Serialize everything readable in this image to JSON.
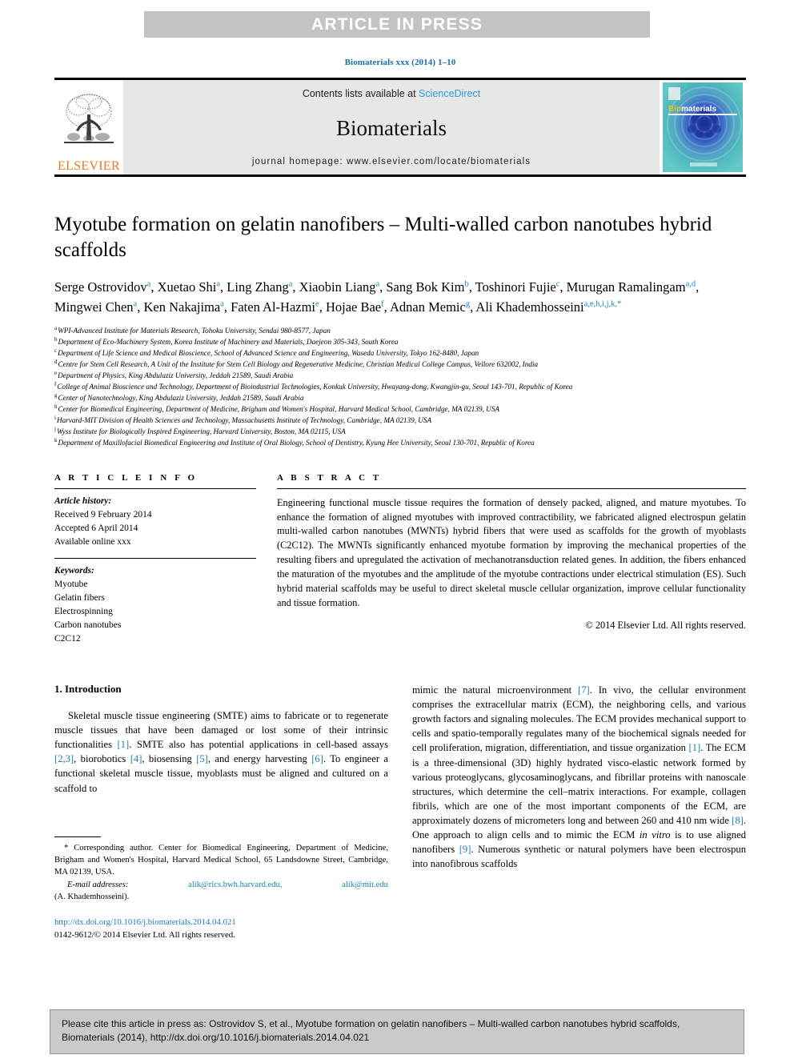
{
  "banner": {
    "label": "ARTICLE IN PRESS"
  },
  "running_head": "Biomaterials xxx (2014) 1–10",
  "masthead": {
    "contents_prefix": "Contents lists available at ",
    "sciencedirect": "ScienceDirect",
    "journal_name": "Biomaterials",
    "homepage": "journal homepage: www.elsevier.com/locate/biomaterials",
    "publisher_wordmark": "ELSEVIER",
    "cover_title_prefix": "Bio",
    "cover_title_suffix": "materials",
    "accent_link": "#2a9fd6",
    "accent_orange": "#e87722",
    "accent_blue": "#1a7fb5"
  },
  "article": {
    "title": "Myotube formation on gelatin nanofibers – Multi-walled carbon nanotubes hybrid scaffolds",
    "authors_html": "Serge Ostrovidov<sup>a</sup>, Xuetao Shi<sup>a</sup>, Ling Zhang<sup>a</sup>, Xiaobin Liang<sup>a</sup>, Sang Bok Kim<sup>b</sup>, Toshinori Fujie<sup>c</sup>, Murugan Ramalingam<sup>a,d</sup>, Mingwei Chen<sup>a</sup>, Ken Nakajima<sup>a</sup>, Faten Al-Hazmi<sup>e</sup>, Hojae Bae<sup>f</sup>, Adnan Memic<sup>g</sup>, Ali Khademhosseini<sup>a,e,h,i,j,k,</sup><sup>*</sup>",
    "affiliations": [
      {
        "mark": "a",
        "text": "WPI-Advanced Institute for Materials Research, Tohoku University, Sendai 980-8577, Japan"
      },
      {
        "mark": "b",
        "text": "Department of Eco-Machinery System, Korea Institute of Machinery and Materials, Daejeon 305-343, South Korea"
      },
      {
        "mark": "c",
        "text": "Department of Life Science and Medical Bioscience, School of Advanced Science and Engineering, Waseda University, Tokyo 162-8480, Japan"
      },
      {
        "mark": "d",
        "text": "Centre for Stem Cell Research, A Unit of the Institute for Stem Cell Biology and Regenerative Medicine, Christian Medical College Campus, Vellore 632002, India"
      },
      {
        "mark": "e",
        "text": "Department of Physics, King Abdulaziz University, Jeddah 21589, Saudi Arabia"
      },
      {
        "mark": "f",
        "text": "College of Animal Bioscience and Technology, Department of Bioindustrial Technologies, Konkuk University, Hwayang-dong, Kwangjin-gu, Seoul 143-701, Republic of Korea"
      },
      {
        "mark": "g",
        "text": "Center of Nanotechnology, King Abdulaziz University, Jeddah 21589, Saudi Arabia"
      },
      {
        "mark": "h",
        "text": "Center for Biomedical Engineering, Department of Medicine, Brigham and Women's Hospital, Harvard Medical School, Cambridge, MA 02139, USA"
      },
      {
        "mark": "i",
        "text": "Harvard-MIT Division of Health Sciences and Technology, Massachusetts Institute of Technology, Cambridge, MA 02139, USA"
      },
      {
        "mark": "j",
        "text": "Wyss Institute for Biologically Inspired Engineering, Harvard University, Boston, MA 02115, USA"
      },
      {
        "mark": "k",
        "text": "Department of Maxillofacial Biomedical Engineering and Institute of Oral Biology, School of Dentistry, Kyung Hee University, Seoul 130-701, Republic of Korea"
      }
    ]
  },
  "article_info": {
    "heading": "A R T I C L E   I N F O",
    "history_label": "Article history:",
    "history": [
      "Received 9 February 2014",
      "Accepted 6 April 2014",
      "Available online xxx"
    ],
    "keywords_label": "Keywords:",
    "keywords": [
      "Myotube",
      "Gelatin fibers",
      "Electrospinning",
      "Carbon nanotubes",
      "C2C12"
    ]
  },
  "abstract": {
    "heading": "A B S T R A C T",
    "body": "Engineering functional muscle tissue requires the formation of densely packed, aligned, and mature myotubes. To enhance the formation of aligned myotubes with improved contractibility, we fabricated aligned electrospun gelatin multi-walled carbon nanotubes (MWNTs) hybrid fibers that were used as scaffolds for the growth of myoblasts (C2C12). The MWNTs significantly enhanced myotube formation by improving the mechanical properties of the resulting fibers and upregulated the activation of mechanotransduction related genes. In addition, the fibers enhanced the maturation of the myotubes and the amplitude of the myotube contractions under electrical stimulation (ES). Such hybrid material scaffolds may be useful to direct skeletal muscle cellular organization, improve cellular functionality and tissue formation.",
    "copyright": "© 2014 Elsevier Ltd. All rights reserved."
  },
  "introduction": {
    "heading": "1. Introduction",
    "left_paragraph_html": "Skeletal muscle tissue engineering (SMTE) aims to fabricate or to regenerate muscle tissues that have been damaged or lost some of their intrinsic functionalities <span class=\"ref\">[1]</span>. SMTE also has potential applications in cell-based assays <span class=\"ref\">[2,3]</span>, biorobotics <span class=\"ref\">[4]</span>, biosensing <span class=\"ref\">[5]</span>, and energy harvesting <span class=\"ref\">[6]</span>. To engineer a functional skeletal muscle tissue, myoblasts must be aligned and cultured on a scaffold to",
    "right_paragraph_html": "mimic the natural microenvironment <span class=\"ref\">[7]</span>. In vivo, the cellular environment comprises the extracellular matrix (ECM), the neighboring cells, and various growth factors and signaling molecules. The ECM provides mechanical support to cells and spatio-temporally regulates many of the biochemical signals needed for cell proliferation, migration, differentiation, and tissue organization <span class=\"ref\">[1]</span>. The ECM is a three-dimensional (3D) highly hydrated visco-elastic network formed by various proteoglycans, glycosaminoglycans, and fibrillar proteins with nanoscale structures, which determine the cell–matrix interactions. For example, collagen fibrils, which are one of the most important components of the ECM, are approximately dozens of micrometers long and between 260 and 410 nm wide <span class=\"ref\">[8]</span>. One approach to align cells and to mimic the ECM <i>in vitro</i> is to use aligned nanofibers <span class=\"ref\">[9]</span>. Numerous synthetic or natural polymers have been electrospun into nanofibrous scaffolds"
  },
  "footnote": {
    "corresponding_html": "* Corresponding author. Center for Biomedical Engineering, Department of Medicine, Brigham and Women's Hospital, Harvard Medical School, 65 Landsdowne Street, Cambridge, MA 02139, USA.",
    "email_label": "E-mail addresses:",
    "email_1": "alik@rics.bwh.harvard.edu,",
    "email_2": "alik@mit.edu",
    "email_attrib": "(A. Khademhosseini).",
    "doi_url": "http://dx.doi.org/10.1016/j.biomaterials.2014.04.021",
    "issn_line": "0142-9612/© 2014 Elsevier Ltd. All rights reserved."
  },
  "citation_box": {
    "text": "Please cite this article in press as: Ostrovidov S, et al., Myotube formation on gelatin nanofibers – Multi-walled carbon nanotubes hybrid scaffolds, Biomaterials (2014), http://dx.doi.org/10.1016/j.biomaterials.2014.04.021"
  }
}
